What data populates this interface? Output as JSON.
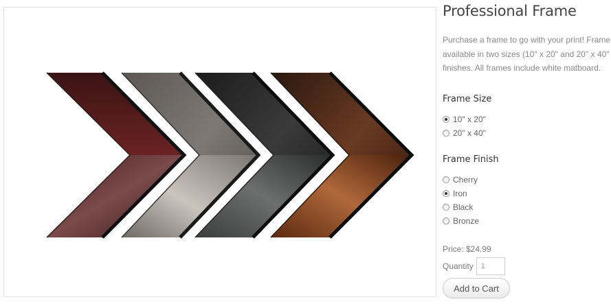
{
  "product": {
    "title": "Professional Frame",
    "description_lines": [
      "Purchase a frame to go with your print! Frame",
      "available in two sizes (10\" x 20\" and 20\" x 40\"",
      "finishes. All frames include white matboard."
    ],
    "image_alt": "frame-corner-samples"
  },
  "frame_size": {
    "label": "Frame Size",
    "options": [
      {
        "label": "10\" x 20\"",
        "selected": true
      },
      {
        "label": "20\" x 40\"",
        "selected": false
      }
    ]
  },
  "frame_finish": {
    "label": "Frame Finish",
    "options": [
      {
        "label": "Cherry",
        "selected": false
      },
      {
        "label": "Iron",
        "selected": true
      },
      {
        "label": "Black",
        "selected": false
      },
      {
        "label": "Bronze",
        "selected": false
      }
    ]
  },
  "purchase": {
    "price_text": "Price: $24.99",
    "quantity_label": "Quantity",
    "quantity_value": "1",
    "add_to_cart_label": "Add to Cart"
  },
  "colors": {
    "cherry": "#5a1f1e",
    "iron": "#8a8580",
    "black": "#2a2a2a",
    "bronze": "#7a3e1c"
  }
}
